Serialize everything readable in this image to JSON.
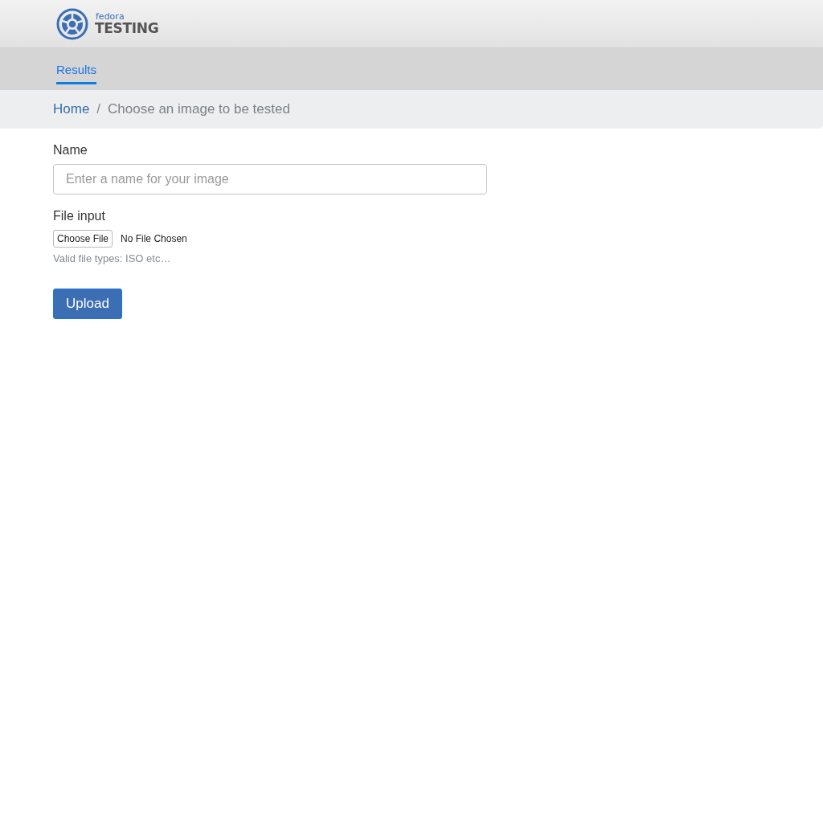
{
  "header": {
    "logo": {
      "brand": "fedora",
      "product": "TESTING"
    }
  },
  "nav": {
    "tabs": [
      {
        "label": "Results",
        "selected": true
      }
    ]
  },
  "breadcrumb": {
    "items": [
      {
        "label": "Home",
        "kind": "link"
      },
      {
        "label": "Choose an image to be tested",
        "kind": "current"
      }
    ],
    "separator": "/"
  },
  "form": {
    "name_field": {
      "label": "Name",
      "placeholder": "Enter a name for your image"
    },
    "file_field": {
      "label": "File input",
      "button": "Choose File",
      "status": "No File Chosen",
      "help": "Valid file types: ISO etc…"
    },
    "submit": "Upload"
  }
}
